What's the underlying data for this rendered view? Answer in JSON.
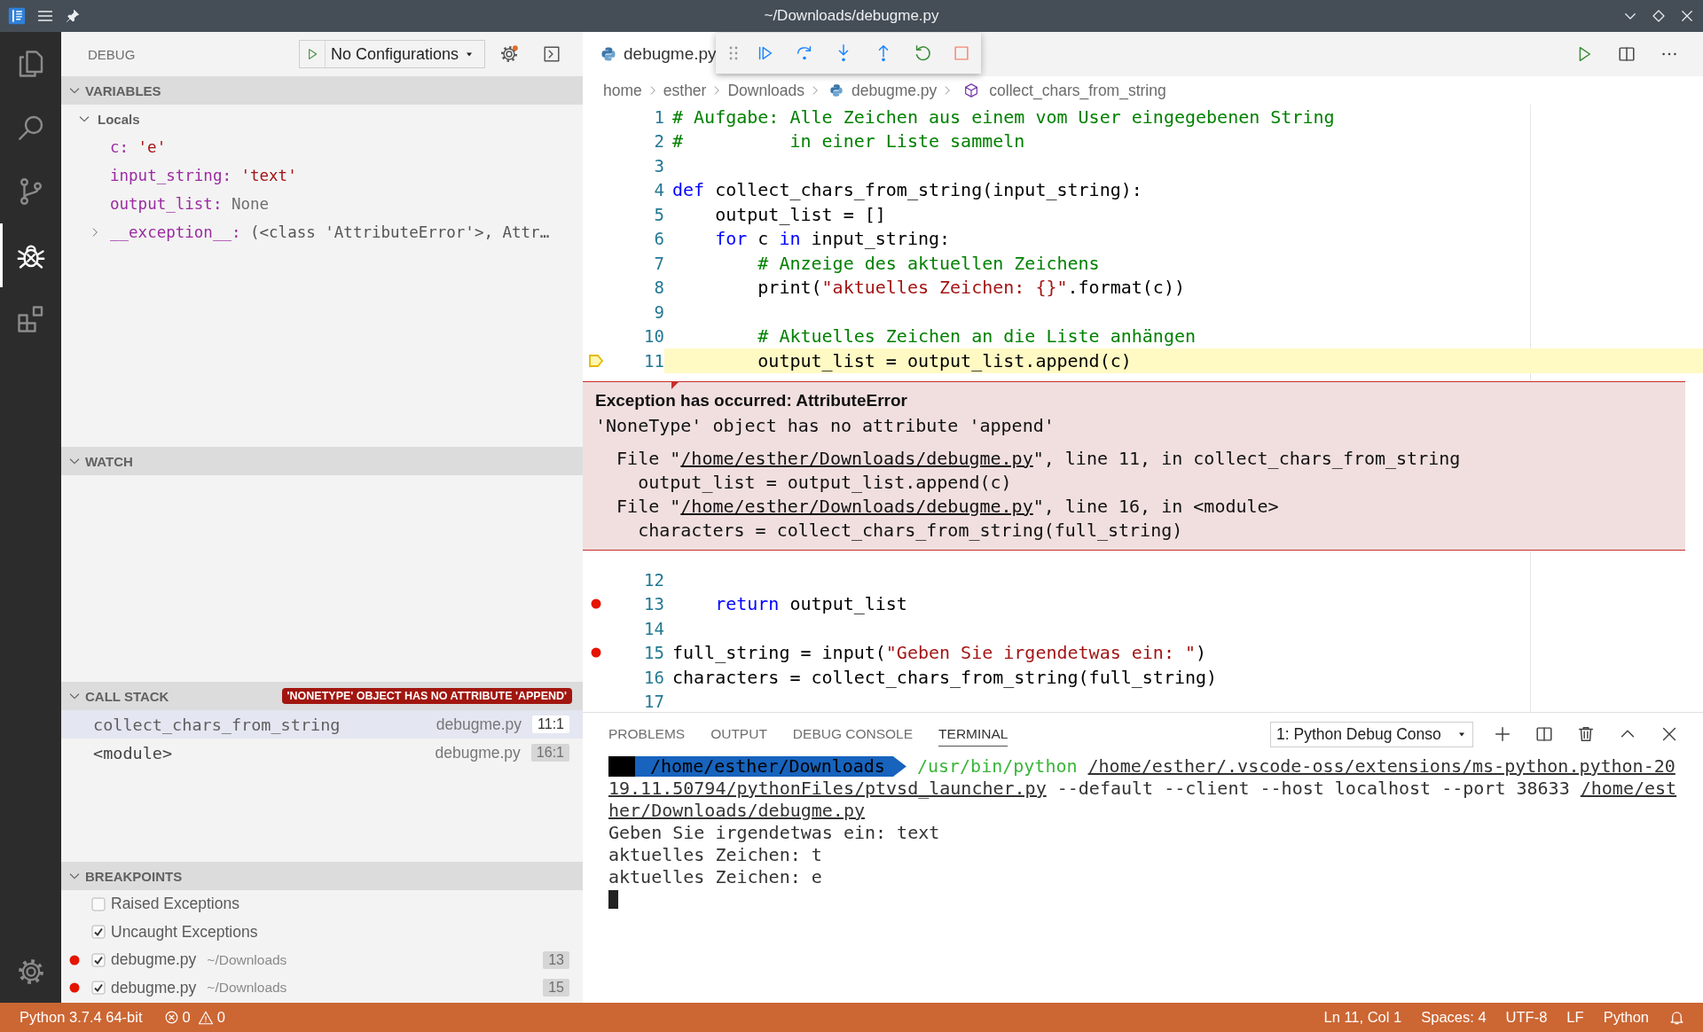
{
  "window": {
    "title": "~/Downloads/debugme.py"
  },
  "activity_bar": {
    "items": [
      {
        "kind": "explorer",
        "selected": false
      },
      {
        "kind": "search",
        "selected": false
      },
      {
        "kind": "source_control",
        "selected": false
      },
      {
        "kind": "debug",
        "selected": true
      },
      {
        "kind": "extensions",
        "selected": false
      }
    ]
  },
  "sidebar": {
    "title": "DEBUG",
    "configuration": "No Configurations",
    "variables": {
      "title": "VARIABLES",
      "expanded": true,
      "scopes": [
        {
          "name": "Locals",
          "expanded": true,
          "children": [
            {
              "name": "c:",
              "value": "'e'",
              "kind": "string"
            },
            {
              "name": "input_string:",
              "value": "'text'",
              "kind": "string"
            },
            {
              "name": "output_list:",
              "value": "None",
              "kind": "none"
            },
            {
              "name": "__exception__:",
              "value": "(<class 'AttributeError'>, Attr…",
              "kind": "object",
              "expanded": false
            }
          ]
        }
      ]
    },
    "watch": {
      "title": "WATCH",
      "expanded": true
    },
    "call_stack": {
      "title": "CALL STACK",
      "expanded": true,
      "badge": "'NONETYPE' OBJECT HAS NO ATTRIBUTE 'APPEND'",
      "frames": [
        {
          "name": "collect_chars_from_string",
          "file": "debugme.py",
          "position": "11:1",
          "selected": true
        },
        {
          "name": "<module>",
          "file": "debugme.py",
          "position": "16:1",
          "selected": false
        }
      ]
    },
    "breakpoints": {
      "title": "BREAKPOINTS",
      "expanded": true,
      "items": [
        {
          "kind": "exception",
          "label": "Raised Exceptions",
          "checked": false
        },
        {
          "kind": "exception",
          "label": "Uncaught Exceptions",
          "checked": true
        },
        {
          "kind": "file",
          "label": "debugme.py",
          "path": "~/Downloads",
          "line": "13",
          "checked": true
        },
        {
          "kind": "file",
          "label": "debugme.py",
          "path": "~/Downloads",
          "line": "15",
          "checked": true
        }
      ]
    }
  },
  "editor": {
    "tabs": [
      {
        "label": "debugme.py",
        "selected": true
      }
    ],
    "breadcrumbs": [
      {
        "kind": "folder",
        "text": "home"
      },
      {
        "kind": "folder",
        "text": "esther"
      },
      {
        "kind": "folder",
        "text": "Downloads"
      },
      {
        "kind": "file",
        "text": "debugme.py"
      },
      {
        "kind": "symbol",
        "text": "collect_chars_from_string"
      }
    ],
    "lines": [
      {
        "number": "1",
        "breakpoint": false,
        "current": false,
        "tokens": [
          {
            "kind": "comment",
            "text": "# Aufgabe: Alle Zeichen aus einem vom User eingegebenen String"
          }
        ]
      },
      {
        "number": "2",
        "breakpoint": false,
        "current": false,
        "tokens": [
          {
            "kind": "comment",
            "text": "#          in einer Liste sammeln"
          }
        ]
      },
      {
        "number": "3",
        "breakpoint": false,
        "current": false
      },
      {
        "number": "4",
        "breakpoint": false,
        "current": false,
        "tokens": [
          {
            "kind": "keyword",
            "text": "def"
          },
          {
            "kind": "plain",
            "text": " collect_chars_from_string(input_string):"
          }
        ]
      },
      {
        "number": "5",
        "breakpoint": false,
        "current": false,
        "tokens": [
          {
            "kind": "plain",
            "text": "    output_list = []"
          }
        ]
      },
      {
        "number": "6",
        "breakpoint": false,
        "current": false,
        "tokens": [
          {
            "kind": "keyword",
            "text": "    for"
          },
          {
            "kind": "plain",
            "text": " c "
          },
          {
            "kind": "keyword",
            "text": "in"
          },
          {
            "kind": "plain",
            "text": " input_string:"
          }
        ]
      },
      {
        "number": "7",
        "breakpoint": false,
        "current": false,
        "tokens": [
          {
            "kind": "comment",
            "text": "        # Anzeige des aktuellen Zeichens"
          }
        ]
      },
      {
        "number": "8",
        "breakpoint": false,
        "current": false,
        "tokens": [
          {
            "kind": "plain",
            "text": "        print("
          },
          {
            "kind": "string",
            "text": "\"aktuelles Zeichen: {}\""
          },
          {
            "kind": "plain",
            "text": ".format(c))"
          }
        ]
      },
      {
        "number": "9",
        "breakpoint": false,
        "current": false
      },
      {
        "number": "10",
        "breakpoint": false,
        "current": false,
        "tokens": [
          {
            "kind": "comment",
            "text": "        # Aktuelles Zeichen an die Liste anhängen"
          }
        ]
      },
      {
        "number": "11",
        "breakpoint": false,
        "current": true,
        "tokens": [
          {
            "kind": "plain",
            "text": "        output_list = output_list.append(c)"
          }
        ]
      }
    ],
    "exception": {
      "title": "Exception has occurred: AttributeError",
      "message": "'NoneType' object has no attribute 'append'",
      "trace": [
        {
          "segments": [
            {
              "kind": "plain",
              "text": "  File \""
            },
            {
              "kind": "link",
              "text": "/home/esther/Downloads/debugme.py"
            },
            {
              "kind": "plain",
              "text": "\", line 11, in collect_chars_from_string"
            }
          ]
        },
        {
          "segments": [
            {
              "kind": "plain",
              "text": "    output_list = output_list.append(c)"
            }
          ]
        },
        {
          "segments": [
            {
              "kind": "plain",
              "text": "  File \""
            },
            {
              "kind": "link",
              "text": "/home/esther/Downloads/debugme.py"
            },
            {
              "kind": "plain",
              "text": "\", line 16, in <module>"
            }
          ]
        },
        {
          "segments": [
            {
              "kind": "plain",
              "text": "    characters = collect_chars_from_string(full_string)"
            }
          ]
        }
      ]
    },
    "lines_after": [
      {
        "number": "12",
        "breakpoint": false,
        "current": false
      },
      {
        "number": "13",
        "breakpoint": true,
        "current": false,
        "tokens": [
          {
            "kind": "keyword",
            "text": "    return"
          },
          {
            "kind": "plain",
            "text": " output_list"
          }
        ]
      },
      {
        "number": "14",
        "breakpoint": false,
        "current": false
      },
      {
        "number": "15",
        "breakpoint": true,
        "current": false,
        "tokens": [
          {
            "kind": "plain",
            "text": "full_string = input("
          },
          {
            "kind": "string",
            "text": "\"Geben Sie irgendetwas ein: \""
          },
          {
            "kind": "plain",
            "text": ")"
          }
        ]
      },
      {
        "number": "16",
        "breakpoint": false,
        "current": false,
        "tokens": [
          {
            "kind": "plain",
            "text": "characters = collect_chars_from_string(full_string)"
          }
        ]
      },
      {
        "number": "17",
        "breakpoint": false,
        "current": false
      }
    ]
  },
  "debug_toolbar": {
    "actions": [
      {
        "kind": "continue"
      },
      {
        "kind": "step_over"
      },
      {
        "kind": "step_into"
      },
      {
        "kind": "step_out"
      },
      {
        "kind": "restart"
      },
      {
        "kind": "stop"
      }
    ]
  },
  "panel": {
    "tabs": [
      {
        "label": "PROBLEMS",
        "selected": false
      },
      {
        "label": "OUTPUT",
        "selected": false
      },
      {
        "label": "DEBUG CONSOLE",
        "selected": false
      },
      {
        "label": "TERMINAL",
        "selected": true
      }
    ],
    "terminal_select": "1: Python Debug Conso",
    "terminal": {
      "cursor": true,
      "lines": [
        {
          "segments": [
            {
              "kind": "prompt",
              "text": "/home/esther/Downloads"
            },
            {
              "kind": "command",
              "text": "/usr/bin/python"
            },
            {
              "kind": "link",
              "text": "/home/esther/.vscode-oss/extensions/ms-python.python-20"
            }
          ]
        },
        {
          "segments": [
            {
              "kind": "link",
              "text": "19.11.50794/pythonFiles/ptvsd_launcher.py"
            },
            {
              "kind": "plain",
              "text": " --default --client --host localhost --port 38633 "
            },
            {
              "kind": "link",
              "text": "/home/est"
            }
          ]
        },
        {
          "segments": [
            {
              "kind": "link",
              "text": "her/Downloads/debugme.py"
            }
          ]
        },
        {
          "segments": [
            {
              "kind": "plain",
              "text": "Geben Sie irgendetwas ein: text"
            }
          ]
        },
        {
          "segments": [
            {
              "kind": "plain",
              "text": "aktuelles Zeichen: t"
            }
          ]
        },
        {
          "segments": [
            {
              "kind": "plain",
              "text": "aktuelles Zeichen: e"
            }
          ]
        }
      ]
    }
  },
  "status_bar": {
    "interpreter": "Python 3.7.4 64-bit",
    "errors": "0",
    "warnings": "0",
    "right_items": [
      "Ln 11, Col 1",
      "Spaces: 4",
      "UTF-8",
      "LF",
      "Python"
    ]
  }
}
